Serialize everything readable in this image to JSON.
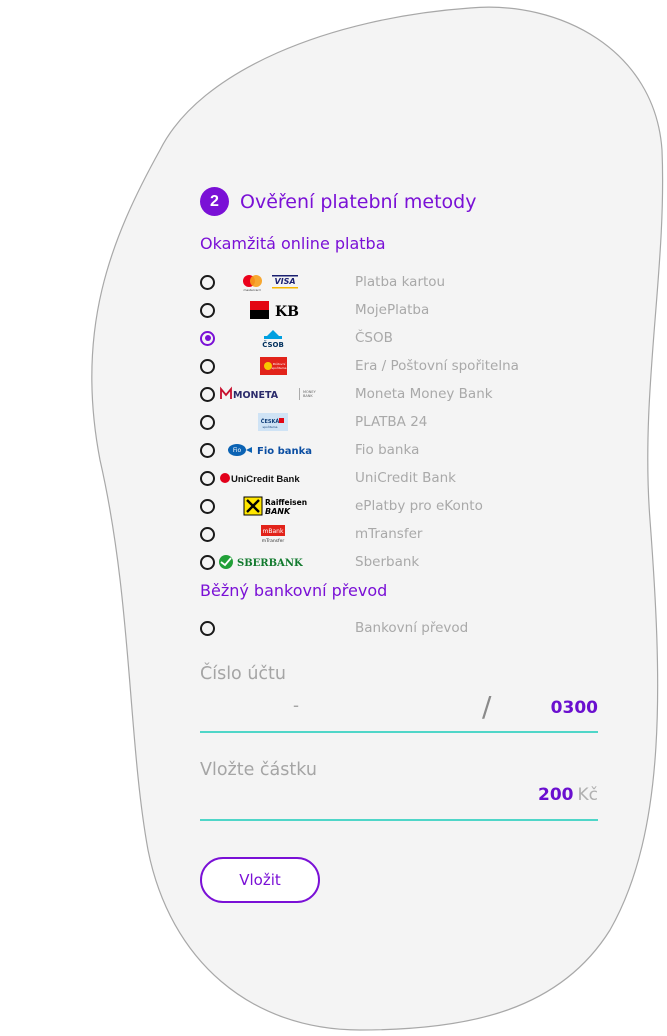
{
  "step": {
    "number": "2",
    "title": "Ověření platební metody"
  },
  "instant_section": "Okamžitá online platba",
  "methods": [
    {
      "label": "Platba kartou",
      "logo": "card-logos"
    },
    {
      "label": "MojePlatba",
      "logo": "KB"
    },
    {
      "label": "ČSOB",
      "logo": "ČSOB"
    },
    {
      "label": "Era / Poštovní spořitelna",
      "logo": "Poštovní spořitelna"
    },
    {
      "label": "Moneta Money Bank",
      "logo": "MONETA"
    },
    {
      "label": "PLATBA 24",
      "logo": "ČESKÁ spořitelna"
    },
    {
      "label": "Fio banka",
      "logo": "Fio banka"
    },
    {
      "label": "UniCredit Bank",
      "logo": "UniCredit Bank"
    },
    {
      "label": "ePlatby pro eKonto",
      "logo": "Raiffeisen BANK"
    },
    {
      "label": "mTransfer",
      "logo": "mBank mTransfer"
    },
    {
      "label": "Sberbank",
      "logo": "SBERBANK"
    }
  ],
  "selected_method": "ČSOB",
  "transfer_section": "Běžný bankovní převod",
  "transfer_option": "Bankovní převod",
  "account": {
    "label": "Číslo účtu",
    "prefix_separator": "-",
    "bank_separator": "/",
    "bank_code": "0300"
  },
  "amount": {
    "label": "Vložte částku",
    "value": "200",
    "currency": "Kč"
  },
  "submit_label": "Vložit",
  "colors": {
    "accent": "#7a10d6",
    "underline": "#4fd6c8",
    "muted": "#a9a9a9"
  }
}
